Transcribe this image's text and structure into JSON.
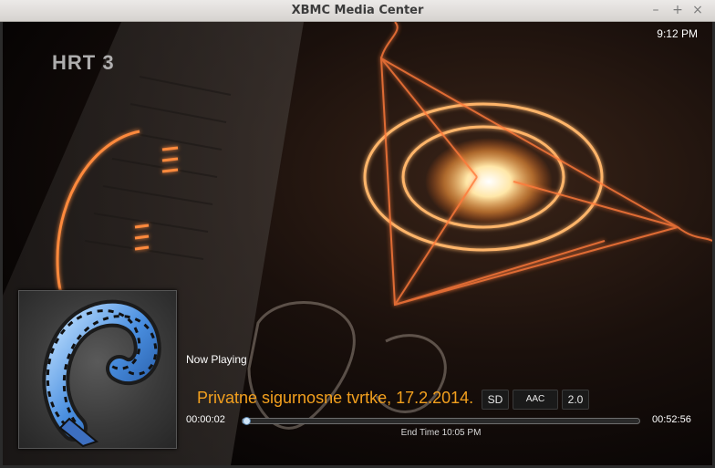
{
  "window": {
    "title": "XBMC Media Center",
    "controls": {
      "minimize": "–",
      "maximize": "+",
      "close": "×"
    }
  },
  "overlay": {
    "clock": "9:12 PM",
    "channel_logo": "HRT 3"
  },
  "now_playing": {
    "heading": "Now Playing",
    "title": "Privatne sigurnosne tvrtke, 17.2.2014.",
    "thumbnail_icon": "film-reel-icon",
    "flags": {
      "resolution": "SD",
      "audio_codec": "AAC",
      "audio_channels": "2.0"
    },
    "time": {
      "current": "00:00:02",
      "total": "00:52:56",
      "end_time": "End Time 10:05 PM"
    },
    "progress_fraction": 0.0006
  },
  "colors": {
    "title_accent": "#f3a01e",
    "progress": "#9bc3e6",
    "glow": "#ff9a3c"
  }
}
